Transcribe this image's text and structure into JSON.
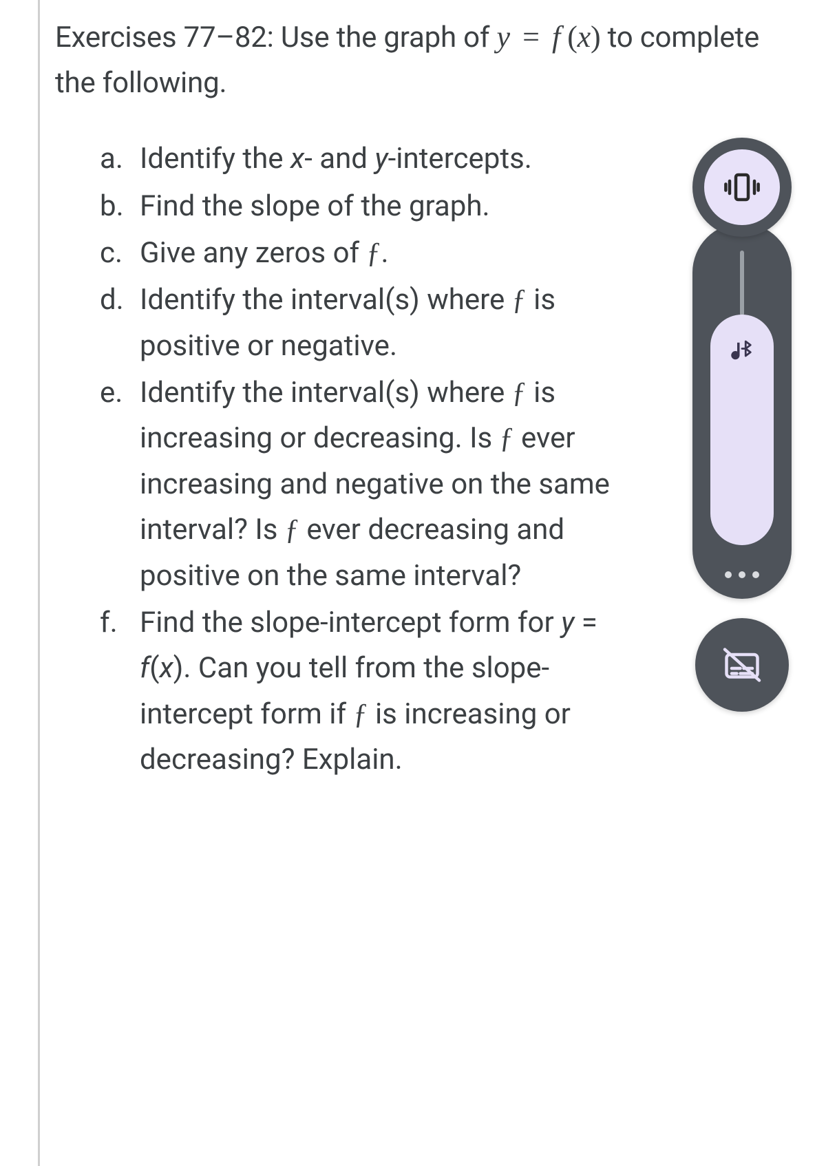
{
  "intro": {
    "prefix": "Exercises 77–82: Use the graph of ",
    "math": "y = f (x)",
    "suffix": " to complete the following."
  },
  "items": [
    {
      "marker": "a.",
      "text": "Identify the x- and y-intercepts."
    },
    {
      "marker": "b.",
      "text": "Find the slope of the graph."
    },
    {
      "marker": "c.",
      "text": "Give any zeros of ƒ."
    },
    {
      "marker": "d.",
      "text": "Identify the interval(s) where ƒ is positive or negative."
    },
    {
      "marker": "e.",
      "text": "Identify the interval(s) where ƒ is increasing or decreasing. Is ƒ ever increasing and negative on the same interval? Is ƒ ever decreasing and positive on the same interval?"
    },
    {
      "marker": "f.",
      "text": "Find the slope-intercept form for y = f(x). Can you tell from the slope-intercept form if ƒ is increasing or decreasing? Explain."
    }
  ],
  "widget": {
    "vibrate_icon": "vibrate",
    "music_icon": "music-bluetooth",
    "more_icon": "more",
    "captions_icon": "captions-off"
  }
}
